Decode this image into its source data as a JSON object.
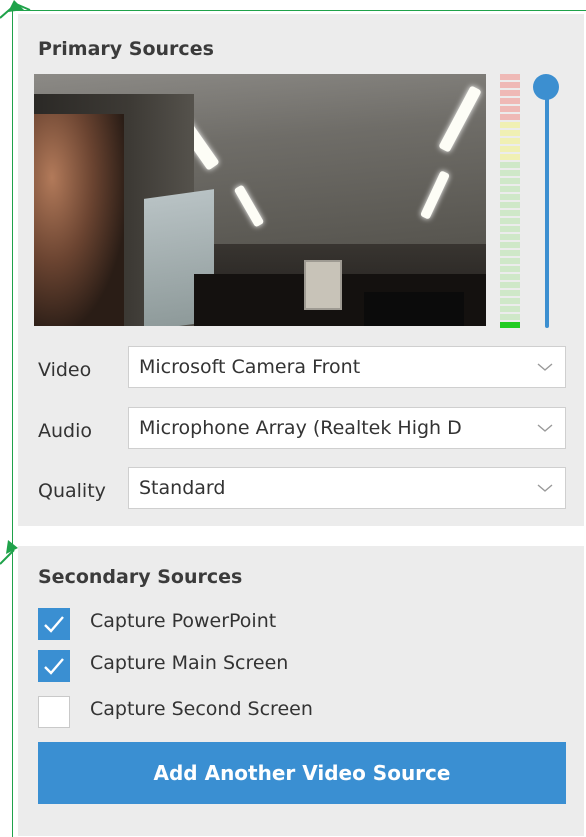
{
  "primary": {
    "title": "Primary Sources",
    "video_label": "Video",
    "video_value": "Microsoft Camera Front",
    "audio_label": "Audio",
    "audio_value": "Microphone Array (Realtek High D",
    "quality_label": "Quality",
    "quality_value": "Standard",
    "volume_level": 0.95
  },
  "secondary": {
    "title": "Secondary Sources",
    "checks": [
      {
        "label": "Capture PowerPoint",
        "checked": true
      },
      {
        "label": "Capture Main Screen",
        "checked": true
      },
      {
        "label": "Capture Second Screen",
        "checked": false
      }
    ],
    "add_button_label": "Add Another Video Source"
  },
  "colors": {
    "accent": "#3a8fd2",
    "annotation": "#1fa24a",
    "meter_green_active": "#22cc22",
    "meter_green": "#cfe8c8",
    "meter_yellow": "#f0f0b4",
    "meter_red": "#efb9b6"
  }
}
